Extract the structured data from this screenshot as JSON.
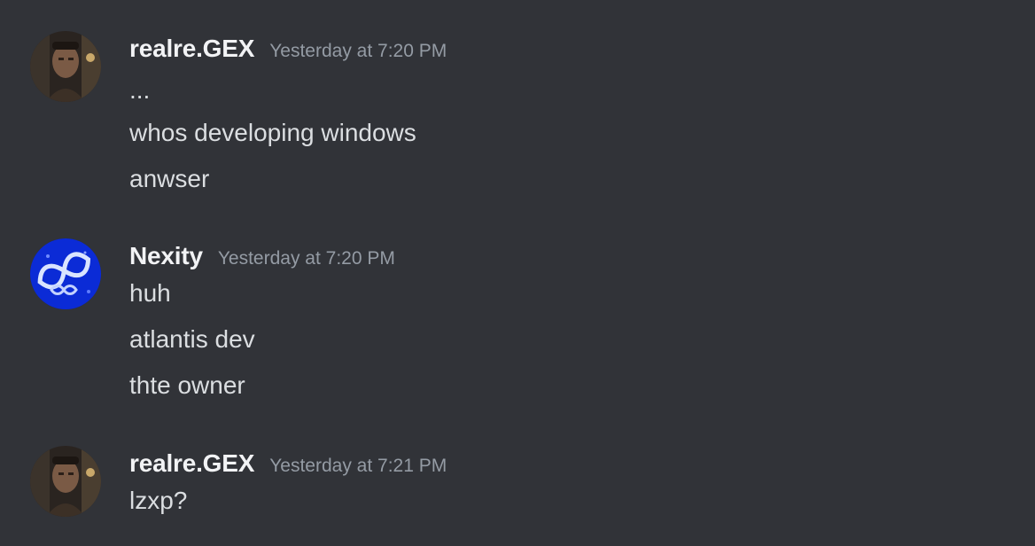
{
  "messages": [
    {
      "author": "realre.GEX",
      "timestamp": "Yesterday at 7:20 PM",
      "avatar_icon": "user-avatar-photo",
      "lines": [
        "...",
        "whos developing windows",
        "anwser"
      ]
    },
    {
      "author": "Nexity",
      "timestamp": "Yesterday at 7:20 PM",
      "avatar_icon": "infinity-logo-avatar",
      "lines": [
        "huh",
        "atlantis dev",
        "thte owner"
      ]
    },
    {
      "author": "realre.GEX",
      "timestamp": "Yesterday at 7:21 PM",
      "avatar_icon": "user-avatar-photo",
      "lines": [
        "lzxp?"
      ]
    }
  ],
  "colors": {
    "background": "#313338",
    "username": "#f2f3f5",
    "timestamp": "#949ba4",
    "message_text": "#dbdee1"
  }
}
